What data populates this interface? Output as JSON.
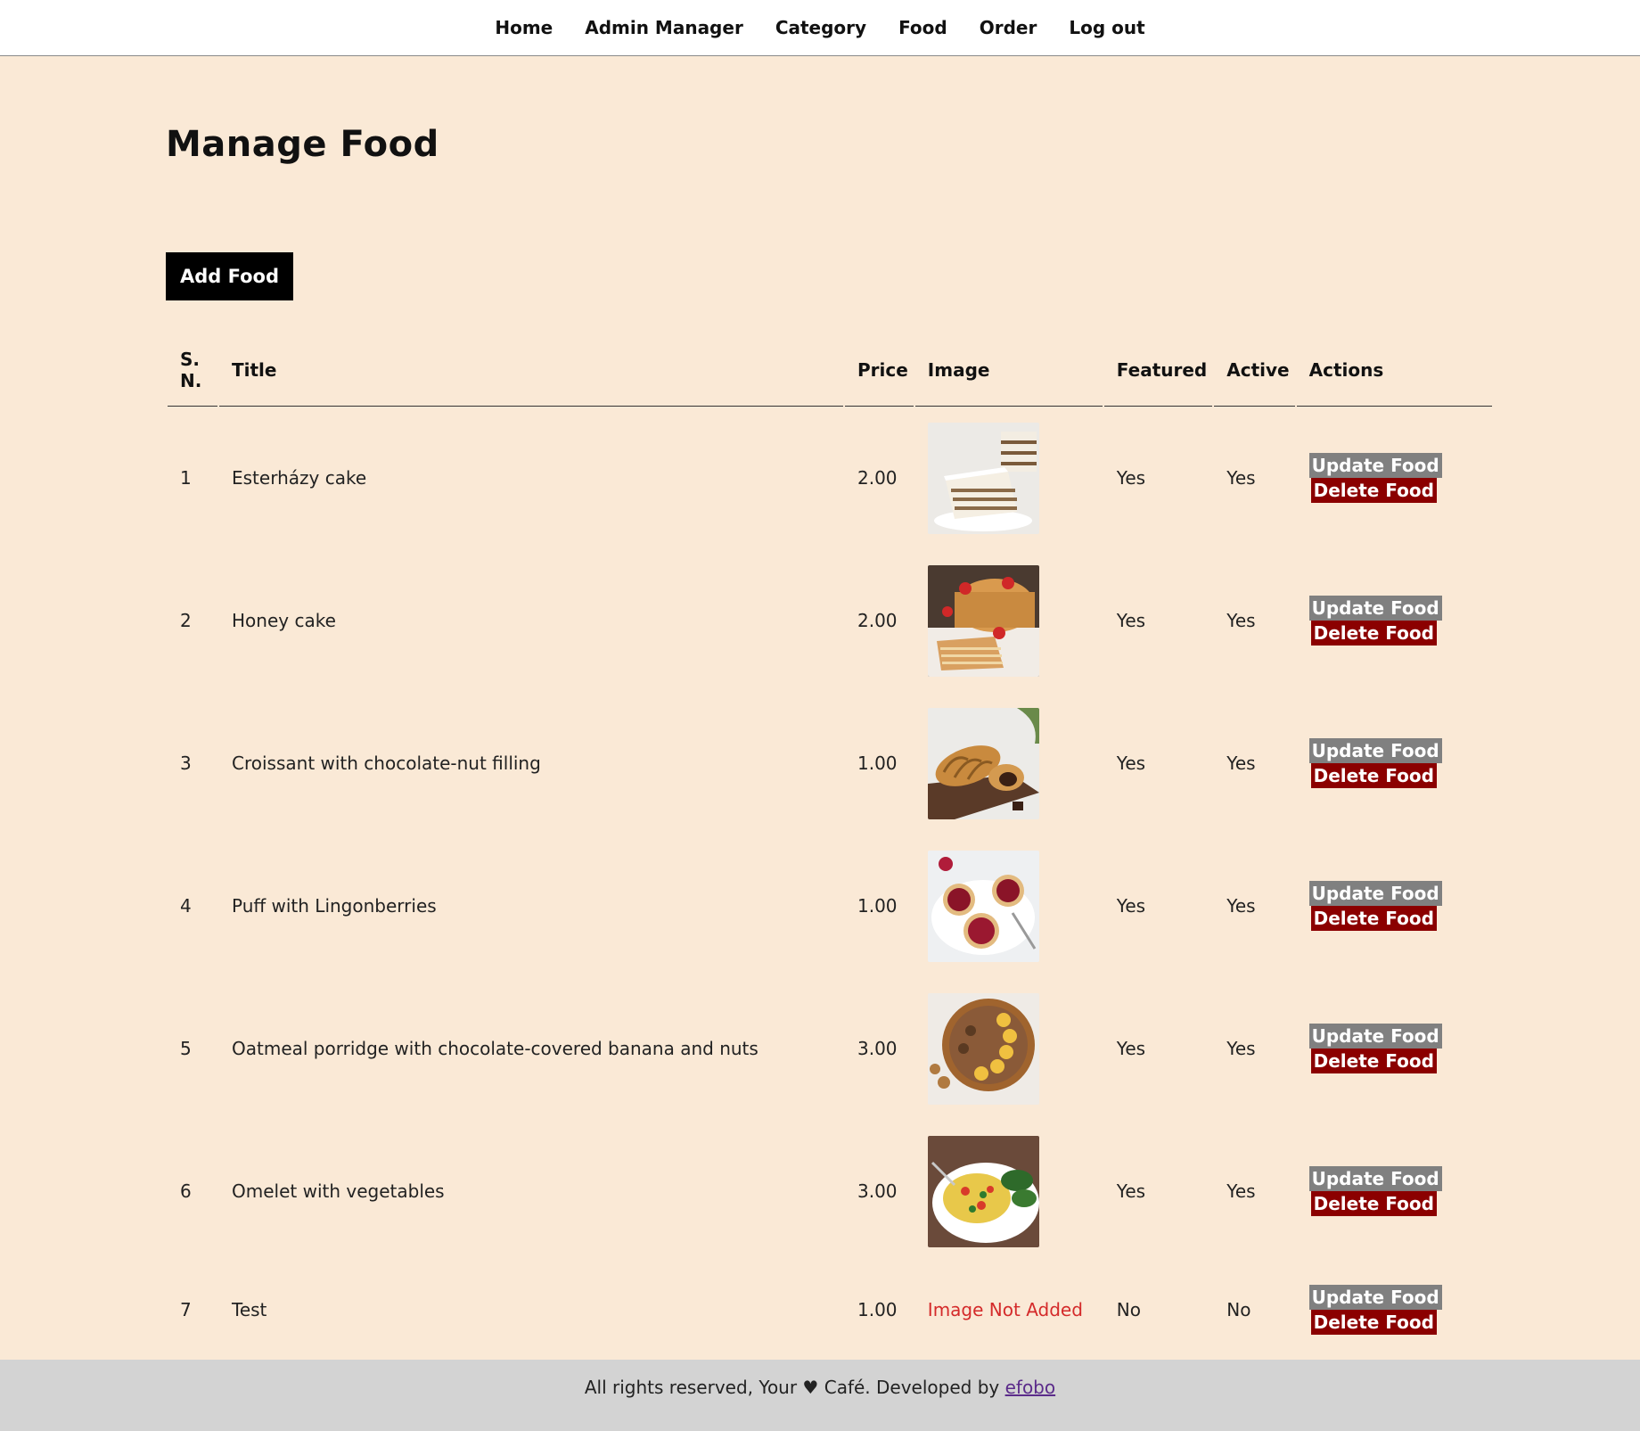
{
  "nav": {
    "items": [
      "Home",
      "Admin Manager",
      "Category",
      "Food",
      "Order",
      "Log out"
    ]
  },
  "page": {
    "title": "Manage Food",
    "add_button": "Add Food"
  },
  "table": {
    "headers": {
      "sn": "S. N.",
      "title": "Title",
      "price": "Price",
      "image": "Image",
      "featured": "Featured",
      "active": "Active",
      "actions": "Actions"
    },
    "update_label": "Update Food",
    "delete_label": "Delete Food",
    "rows": [
      {
        "sn": "1",
        "title": "Esterházy cake",
        "price": "2.00",
        "image": "esterhazy-cake-photo",
        "featured": "Yes",
        "active": "Yes"
      },
      {
        "sn": "2",
        "title": "Honey cake",
        "price": "2.00",
        "image": "honey-cake-photo",
        "featured": "Yes",
        "active": "Yes"
      },
      {
        "sn": "3",
        "title": "Croissant with chocolate-nut filling",
        "price": "1.00",
        "image": "croissant-photo",
        "featured": "Yes",
        "active": "Yes"
      },
      {
        "sn": "4",
        "title": "Puff with Lingonberries",
        "price": "1.00",
        "image": "lingonberry-puff-photo",
        "featured": "Yes",
        "active": "Yes"
      },
      {
        "sn": "5",
        "title": "Oatmeal porridge with chocolate-covered banana and nuts",
        "price": "3.00",
        "image": "oatmeal-porridge-photo",
        "featured": "Yes",
        "active": "Yes"
      },
      {
        "sn": "6",
        "title": "Omelet with vegetables",
        "price": "3.00",
        "image": "omelet-photo",
        "featured": "Yes",
        "active": "Yes"
      },
      {
        "sn": "7",
        "title": "Test",
        "price": "1.00",
        "image_text": "Image Not Added",
        "featured": "No",
        "active": "No"
      }
    ]
  },
  "footer": {
    "text": "All rights reserved, Your ♥ Café. Developed by",
    "link": "efobo"
  },
  "colors": {
    "background": "#fae9d6",
    "update_button": "#808080",
    "delete_button": "#8b0000",
    "image_not_added": "#d42a2a",
    "footer_bg": "#d3d3d3"
  }
}
